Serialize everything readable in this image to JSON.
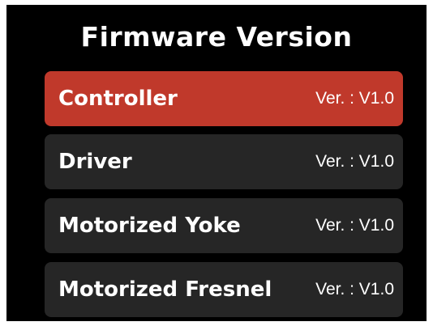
{
  "title": "Firmware Version",
  "colors": {
    "background": "#000000",
    "row": "#262626",
    "selected_row": "#c0392b",
    "text": "#ffffff"
  },
  "selected_index": 0,
  "items": [
    {
      "label": "Controller",
      "version": "Ver. : V1.0"
    },
    {
      "label": "Driver",
      "version": "Ver. : V1.0"
    },
    {
      "label": "Motorized Yoke",
      "version": "Ver. : V1.0"
    },
    {
      "label": "Motorized Fresnel",
      "version": "Ver. : V1.0"
    }
  ]
}
